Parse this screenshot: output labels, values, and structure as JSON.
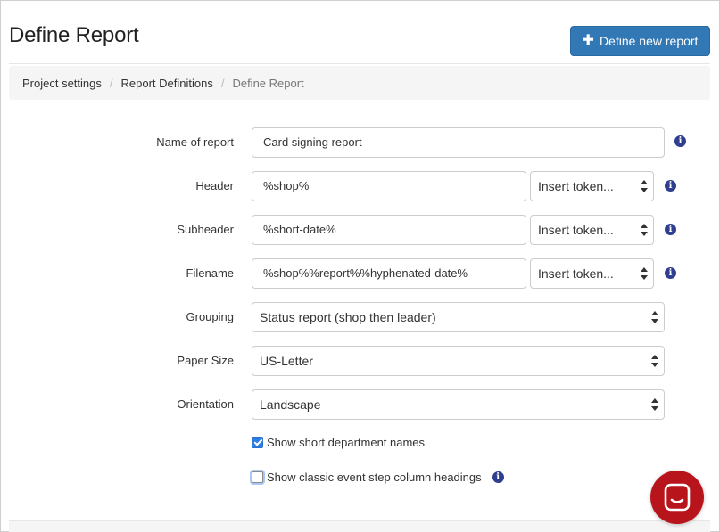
{
  "page": {
    "title": "Define Report",
    "new_report_button": "Define new report"
  },
  "breadcrumb": {
    "items": [
      "Project settings",
      "Report Definitions"
    ],
    "current": "Define Report",
    "separator": "/"
  },
  "form": {
    "name": {
      "label": "Name of report",
      "value": "Card signing report"
    },
    "header": {
      "label": "Header",
      "value": "%shop%",
      "token_select": "Insert token..."
    },
    "subheader": {
      "label": "Subheader",
      "value": "%short-date%",
      "token_select": "Insert token..."
    },
    "filename": {
      "label": "Filename",
      "value": "%shop%%report%%hyphenated-date%",
      "token_select": "Insert token..."
    },
    "grouping": {
      "label": "Grouping",
      "value": "Status report (shop then leader)"
    },
    "paper_size": {
      "label": "Paper Size",
      "value": "US-Letter"
    },
    "orientation": {
      "label": "Orientation",
      "value": "Landscape"
    },
    "short_department_names": {
      "label": "Show short department names",
      "checked": true
    },
    "classic_headings": {
      "label": "Show classic event step column headings",
      "checked": false
    }
  },
  "icons": {
    "info": "info-icon",
    "plus": "plus-icon",
    "chat": "chat-icon",
    "select_arrows": "updown-arrows-icon"
  },
  "colors": {
    "primary": "#3278b5",
    "info_icon": "#2f3e8f",
    "chat_button": "#b8141c",
    "checkbox_checked": "#2f7de1",
    "breadcrumb_bg": "#f5f5f5"
  }
}
